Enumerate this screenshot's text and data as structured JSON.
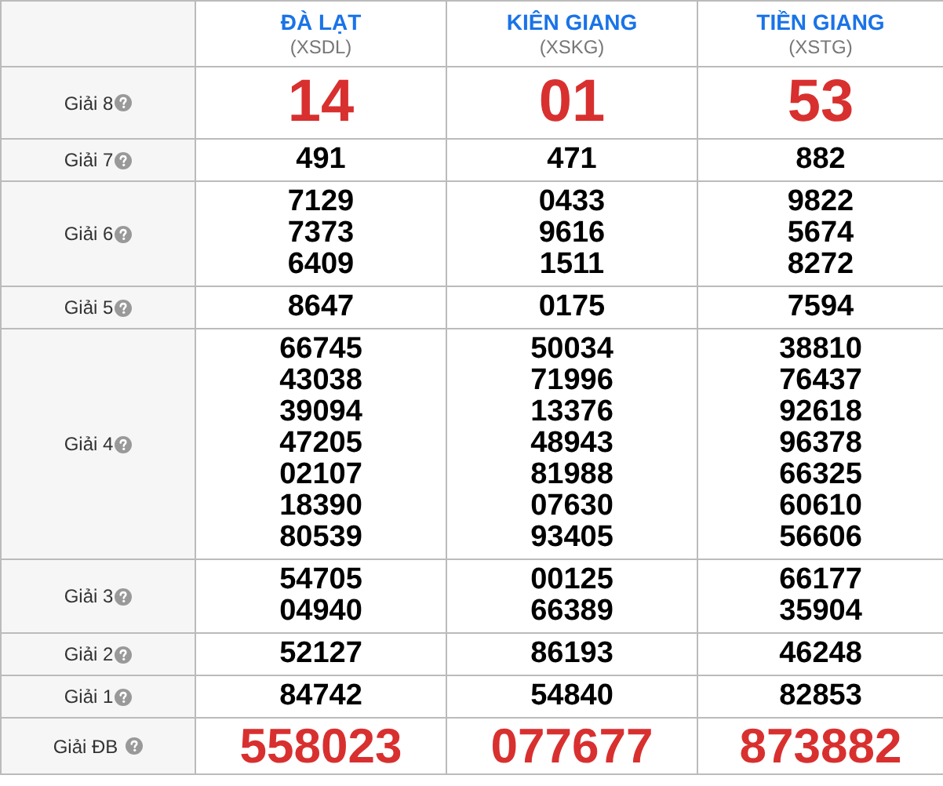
{
  "provinces": [
    {
      "name": "ĐÀ LẠT",
      "code": "(XSDL)"
    },
    {
      "name": "KIÊN GIANG",
      "code": "(XSKG)"
    },
    {
      "name": "TIỀN GIANG",
      "code": "(XSTG)"
    }
  ],
  "prizes": [
    {
      "label": "Giải 8",
      "kind": "big",
      "results": [
        [
          "14"
        ],
        [
          "01"
        ],
        [
          "53"
        ]
      ]
    },
    {
      "label": "Giải 7",
      "kind": "normal",
      "results": [
        [
          "491"
        ],
        [
          "471"
        ],
        [
          "882"
        ]
      ]
    },
    {
      "label": "Giải 6",
      "kind": "normal",
      "results": [
        [
          "7129",
          "7373",
          "6409"
        ],
        [
          "0433",
          "9616",
          "1511"
        ],
        [
          "9822",
          "5674",
          "8272"
        ]
      ]
    },
    {
      "label": "Giải 5",
      "kind": "normal",
      "results": [
        [
          "8647"
        ],
        [
          "0175"
        ],
        [
          "7594"
        ]
      ]
    },
    {
      "label": "Giải 4",
      "kind": "normal",
      "results": [
        [
          "66745",
          "43038",
          "39094",
          "47205",
          "02107",
          "18390",
          "80539"
        ],
        [
          "50034",
          "71996",
          "13376",
          "48943",
          "81988",
          "07630",
          "93405"
        ],
        [
          "38810",
          "76437",
          "92618",
          "96378",
          "66325",
          "60610",
          "56606"
        ]
      ]
    },
    {
      "label": "Giải 3",
      "kind": "normal",
      "results": [
        [
          "54705",
          "04940"
        ],
        [
          "00125",
          "66389"
        ],
        [
          "66177",
          "35904"
        ]
      ]
    },
    {
      "label": "Giải 2",
      "kind": "normal",
      "results": [
        [
          "52127"
        ],
        [
          "86193"
        ],
        [
          "46248"
        ]
      ]
    },
    {
      "label": "Giải 1",
      "kind": "normal",
      "results": [
        [
          "84742"
        ],
        [
          "54840"
        ],
        [
          "82853"
        ]
      ]
    },
    {
      "label": "Giải ĐB",
      "kind": "special",
      "results": [
        [
          "558023"
        ],
        [
          "077677"
        ],
        [
          "873882"
        ]
      ]
    }
  ]
}
